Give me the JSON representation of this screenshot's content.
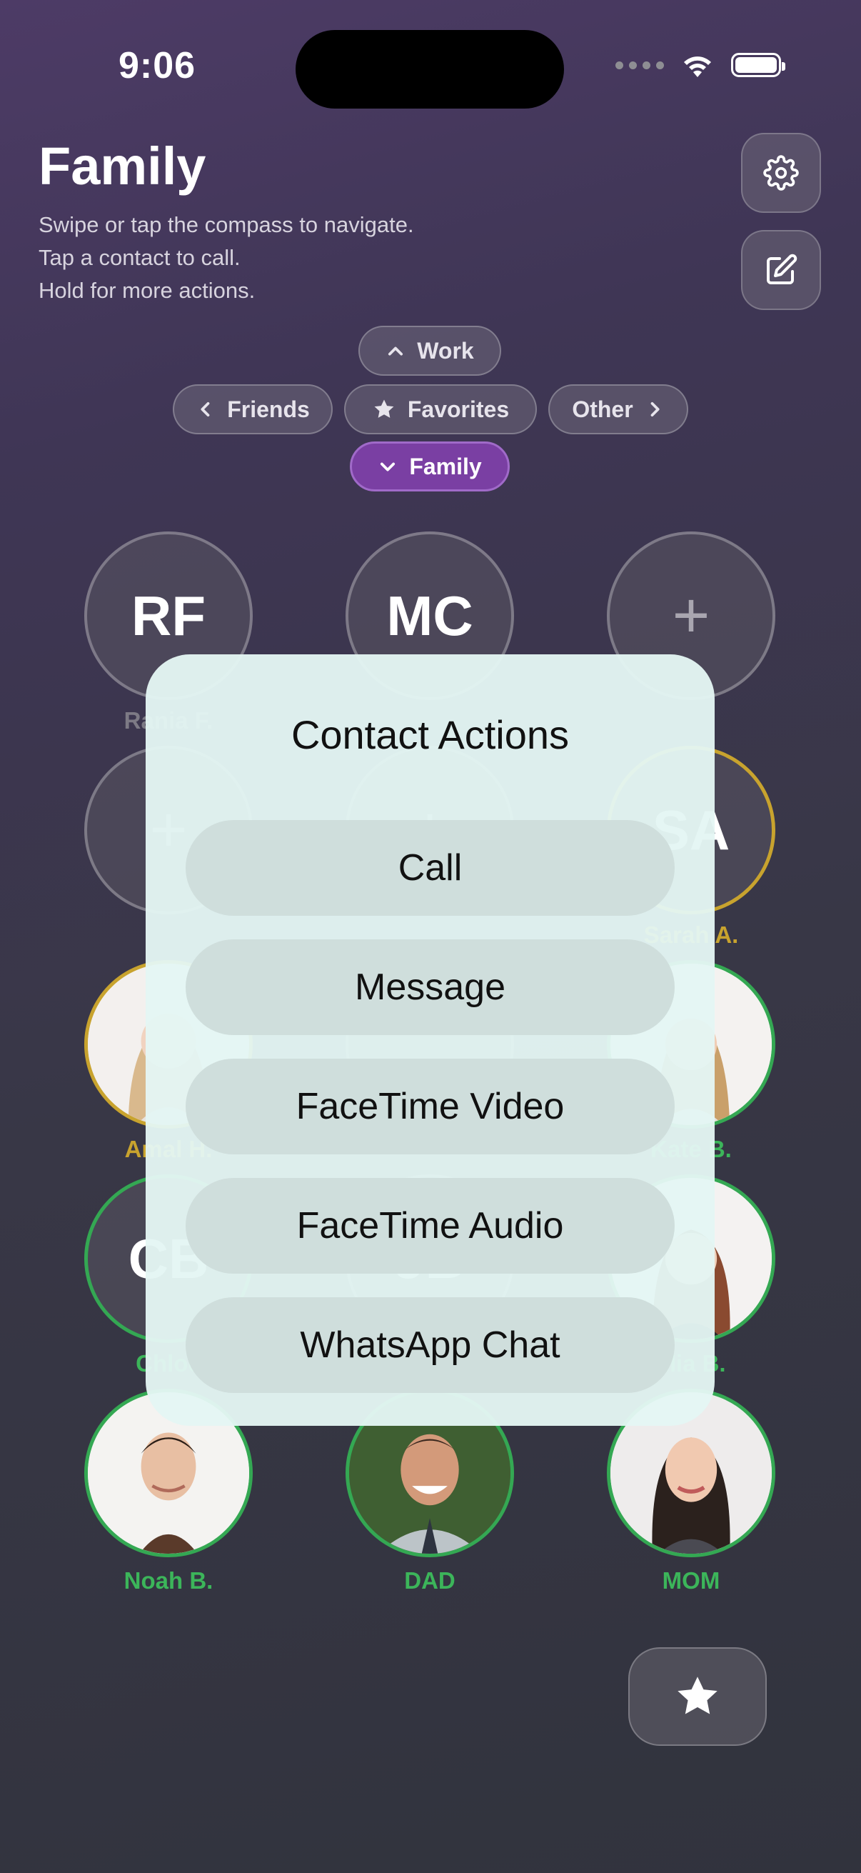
{
  "status_bar": {
    "time": "9:06"
  },
  "header": {
    "title": "Family",
    "subtitle_lines": [
      "Swipe or tap the compass to navigate.",
      "Tap a contact to call.",
      "Hold for more actions."
    ]
  },
  "icons": {
    "settings": "gear-icon",
    "edit": "edit-icon",
    "favorites": "star-icon"
  },
  "compass": {
    "up": "Work",
    "left": "Friends",
    "center": "Favorites",
    "right": "Other",
    "down": "Family",
    "active": "Family"
  },
  "contacts": [
    {
      "initials": "RF",
      "name": "Rania F."
    },
    {
      "initials": "MC",
      "name": ""
    },
    {
      "initials": "+",
      "name": ""
    },
    {
      "initials": "+",
      "name": ""
    },
    {
      "initials": "+",
      "name": ""
    },
    {
      "initials": "SA",
      "name": "Sarah A."
    },
    {
      "initials": "",
      "name": "Amal H."
    },
    {
      "initials": "",
      "name": ""
    },
    {
      "initials": "",
      "name": "Kate B."
    },
    {
      "initials": "CB",
      "name": "Chloe"
    },
    {
      "initials": "JB",
      "name": ""
    },
    {
      "initials": "",
      "name": "Mia B."
    },
    {
      "initials": "",
      "name": "Noah B."
    },
    {
      "initials": "",
      "name": "DAD"
    },
    {
      "initials": "",
      "name": "MOM"
    }
  ],
  "modal": {
    "title": "Contact Actions",
    "actions": [
      "Call",
      "Message",
      "FaceTime Video",
      "FaceTime Audio",
      "WhatsApp Chat"
    ]
  },
  "colors": {
    "accent": "#7a3fa3",
    "favorite_ring": "#c8a32e",
    "active_ring": "#34a853"
  }
}
